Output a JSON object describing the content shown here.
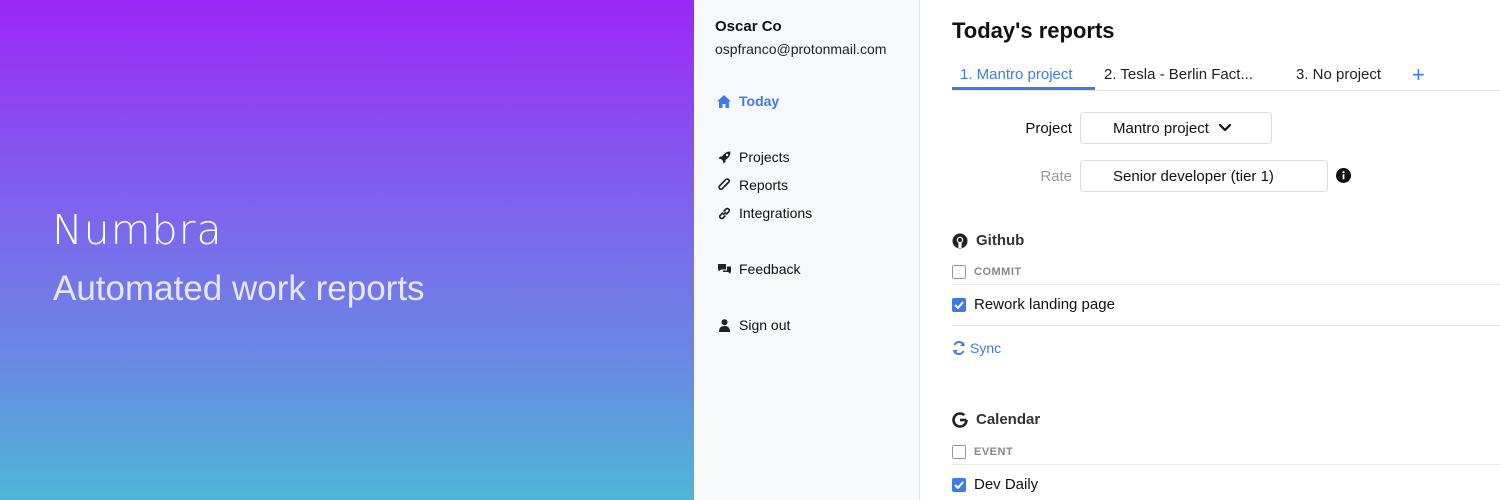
{
  "hero": {
    "brand": "Numbra",
    "tagline": "Automated work reports",
    "gradient_top": "#9c27f7",
    "gradient_bottom": "#4db6d8"
  },
  "sidebar": {
    "user_name": "Oscar Co",
    "user_email": "ospfranco@protonmail.com",
    "items": [
      {
        "label": "Today",
        "icon": "home-icon",
        "active": true
      },
      {
        "label": "Projects",
        "icon": "rocket-icon"
      },
      {
        "label": "Reports",
        "icon": "paperclip-icon"
      },
      {
        "label": "Integrations",
        "icon": "link-icon"
      },
      {
        "label": "Feedback",
        "icon": "chat-bubbles-icon"
      },
      {
        "label": "Sign out",
        "icon": "user-icon"
      }
    ]
  },
  "main": {
    "title": "Today's reports",
    "tabs": [
      {
        "label": "1. Mantro project",
        "active": true
      },
      {
        "label": "2. Tesla - Berlin Fact..."
      },
      {
        "label": "3. No project"
      }
    ],
    "add_tab_label": "+",
    "project_label": "Project",
    "project_value": "Mantro project",
    "rate_label": "Rate",
    "rate_value": "Senior developer (tier 1)",
    "github": {
      "title": "Github",
      "column_header": "COMMIT",
      "rows": [
        {
          "label": "Rework landing page",
          "checked": true
        }
      ],
      "sync_label": "Sync"
    },
    "calendar": {
      "title": "Calendar",
      "column_header": "EVENT",
      "rows": [
        {
          "label": "Dev Daily",
          "checked": true
        }
      ]
    }
  },
  "colors": {
    "accent": "#3f7be6",
    "sidebar_bg": "#f7f8fa"
  }
}
